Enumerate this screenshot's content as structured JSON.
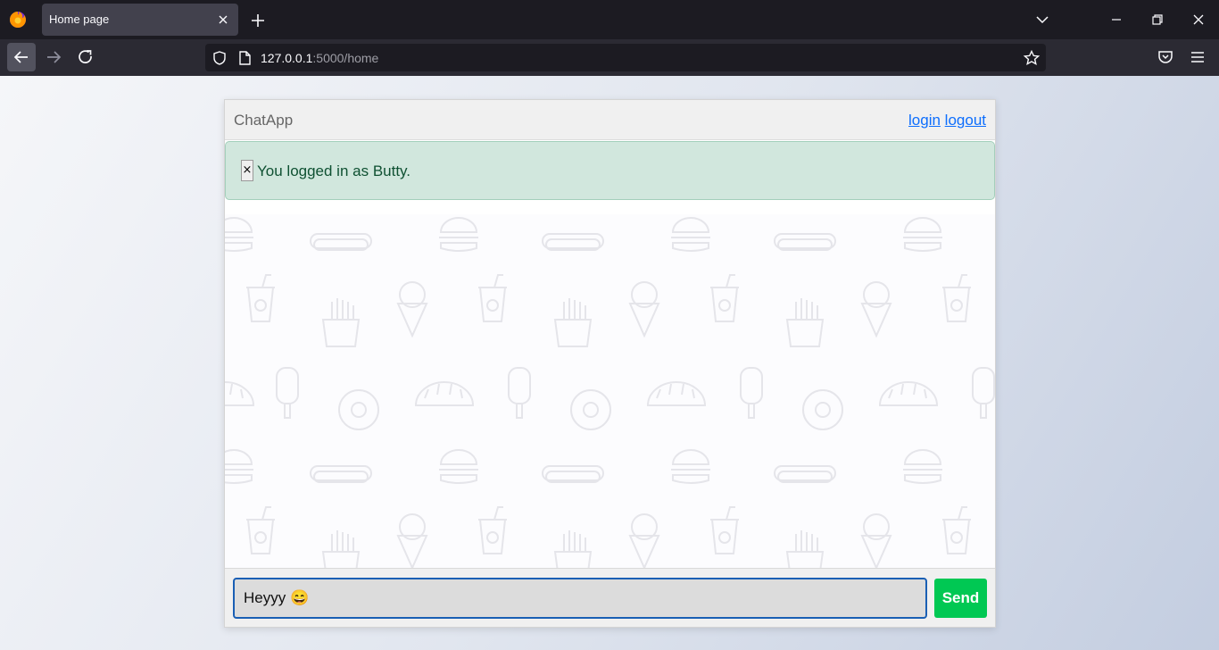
{
  "browser": {
    "tab_title": "Home page",
    "url_host": "127.0.0.1",
    "url_path": ":5000/home",
    "icons": [
      "firefox-logo",
      "close-icon",
      "plus-icon",
      "chevron-down-icon",
      "minimize-icon",
      "restore-icon",
      "close-window-icon",
      "back-arrow-icon",
      "forward-arrow-icon",
      "reload-icon",
      "shield-icon",
      "page-icon",
      "star-icon",
      "pocket-icon",
      "hamburger-menu-icon"
    ]
  },
  "app": {
    "brand": "ChatApp",
    "nav": {
      "login": "login",
      "logout": "logout"
    },
    "alert": {
      "close": "×",
      "message": "You logged in as Butty."
    },
    "composer": {
      "input_value": "Heyyy 😄",
      "send_label": "Send"
    }
  },
  "colors": {
    "accent": "#0d6efd",
    "alert_bg": "#d1e7dd",
    "alert_text": "#0f5132",
    "send_bg": "#00c853",
    "input_border": "#1a5fb4"
  }
}
